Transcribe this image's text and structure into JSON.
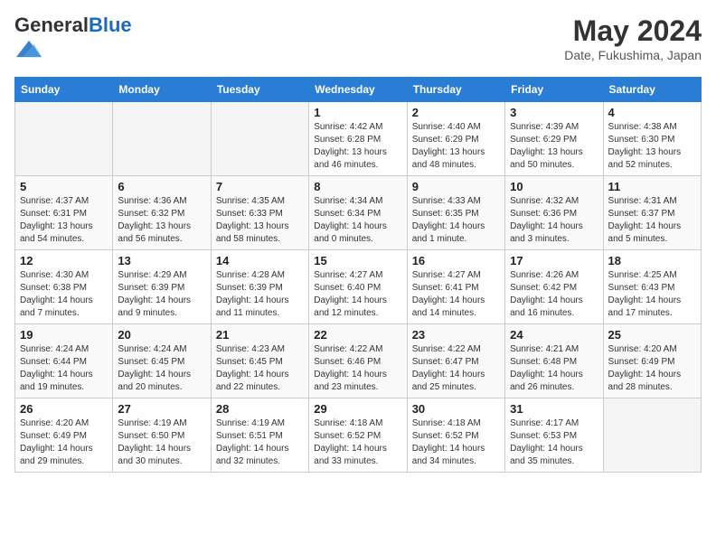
{
  "logo": {
    "general": "General",
    "blue": "Blue"
  },
  "header": {
    "month_year": "May 2024",
    "location": "Date, Fukushima, Japan"
  },
  "columns": [
    "Sunday",
    "Monday",
    "Tuesday",
    "Wednesday",
    "Thursday",
    "Friday",
    "Saturday"
  ],
  "weeks": [
    [
      {
        "day": "",
        "info": ""
      },
      {
        "day": "",
        "info": ""
      },
      {
        "day": "",
        "info": ""
      },
      {
        "day": "1",
        "info": "Sunrise: 4:42 AM\nSunset: 6:28 PM\nDaylight: 13 hours and 46 minutes."
      },
      {
        "day": "2",
        "info": "Sunrise: 4:40 AM\nSunset: 6:29 PM\nDaylight: 13 hours and 48 minutes."
      },
      {
        "day": "3",
        "info": "Sunrise: 4:39 AM\nSunset: 6:29 PM\nDaylight: 13 hours and 50 minutes."
      },
      {
        "day": "4",
        "info": "Sunrise: 4:38 AM\nSunset: 6:30 PM\nDaylight: 13 hours and 52 minutes."
      }
    ],
    [
      {
        "day": "5",
        "info": "Sunrise: 4:37 AM\nSunset: 6:31 PM\nDaylight: 13 hours and 54 minutes."
      },
      {
        "day": "6",
        "info": "Sunrise: 4:36 AM\nSunset: 6:32 PM\nDaylight: 13 hours and 56 minutes."
      },
      {
        "day": "7",
        "info": "Sunrise: 4:35 AM\nSunset: 6:33 PM\nDaylight: 13 hours and 58 minutes."
      },
      {
        "day": "8",
        "info": "Sunrise: 4:34 AM\nSunset: 6:34 PM\nDaylight: 14 hours and 0 minutes."
      },
      {
        "day": "9",
        "info": "Sunrise: 4:33 AM\nSunset: 6:35 PM\nDaylight: 14 hours and 1 minute."
      },
      {
        "day": "10",
        "info": "Sunrise: 4:32 AM\nSunset: 6:36 PM\nDaylight: 14 hours and 3 minutes."
      },
      {
        "day": "11",
        "info": "Sunrise: 4:31 AM\nSunset: 6:37 PM\nDaylight: 14 hours and 5 minutes."
      }
    ],
    [
      {
        "day": "12",
        "info": "Sunrise: 4:30 AM\nSunset: 6:38 PM\nDaylight: 14 hours and 7 minutes."
      },
      {
        "day": "13",
        "info": "Sunrise: 4:29 AM\nSunset: 6:39 PM\nDaylight: 14 hours and 9 minutes."
      },
      {
        "day": "14",
        "info": "Sunrise: 4:28 AM\nSunset: 6:39 PM\nDaylight: 14 hours and 11 minutes."
      },
      {
        "day": "15",
        "info": "Sunrise: 4:27 AM\nSunset: 6:40 PM\nDaylight: 14 hours and 12 minutes."
      },
      {
        "day": "16",
        "info": "Sunrise: 4:27 AM\nSunset: 6:41 PM\nDaylight: 14 hours and 14 minutes."
      },
      {
        "day": "17",
        "info": "Sunrise: 4:26 AM\nSunset: 6:42 PM\nDaylight: 14 hours and 16 minutes."
      },
      {
        "day": "18",
        "info": "Sunrise: 4:25 AM\nSunset: 6:43 PM\nDaylight: 14 hours and 17 minutes."
      }
    ],
    [
      {
        "day": "19",
        "info": "Sunrise: 4:24 AM\nSunset: 6:44 PM\nDaylight: 14 hours and 19 minutes."
      },
      {
        "day": "20",
        "info": "Sunrise: 4:24 AM\nSunset: 6:45 PM\nDaylight: 14 hours and 20 minutes."
      },
      {
        "day": "21",
        "info": "Sunrise: 4:23 AM\nSunset: 6:45 PM\nDaylight: 14 hours and 22 minutes."
      },
      {
        "day": "22",
        "info": "Sunrise: 4:22 AM\nSunset: 6:46 PM\nDaylight: 14 hours and 23 minutes."
      },
      {
        "day": "23",
        "info": "Sunrise: 4:22 AM\nSunset: 6:47 PM\nDaylight: 14 hours and 25 minutes."
      },
      {
        "day": "24",
        "info": "Sunrise: 4:21 AM\nSunset: 6:48 PM\nDaylight: 14 hours and 26 minutes."
      },
      {
        "day": "25",
        "info": "Sunrise: 4:20 AM\nSunset: 6:49 PM\nDaylight: 14 hours and 28 minutes."
      }
    ],
    [
      {
        "day": "26",
        "info": "Sunrise: 4:20 AM\nSunset: 6:49 PM\nDaylight: 14 hours and 29 minutes."
      },
      {
        "day": "27",
        "info": "Sunrise: 4:19 AM\nSunset: 6:50 PM\nDaylight: 14 hours and 30 minutes."
      },
      {
        "day": "28",
        "info": "Sunrise: 4:19 AM\nSunset: 6:51 PM\nDaylight: 14 hours and 32 minutes."
      },
      {
        "day": "29",
        "info": "Sunrise: 4:18 AM\nSunset: 6:52 PM\nDaylight: 14 hours and 33 minutes."
      },
      {
        "day": "30",
        "info": "Sunrise: 4:18 AM\nSunset: 6:52 PM\nDaylight: 14 hours and 34 minutes."
      },
      {
        "day": "31",
        "info": "Sunrise: 4:17 AM\nSunset: 6:53 PM\nDaylight: 14 hours and 35 minutes."
      },
      {
        "day": "",
        "info": ""
      }
    ]
  ]
}
